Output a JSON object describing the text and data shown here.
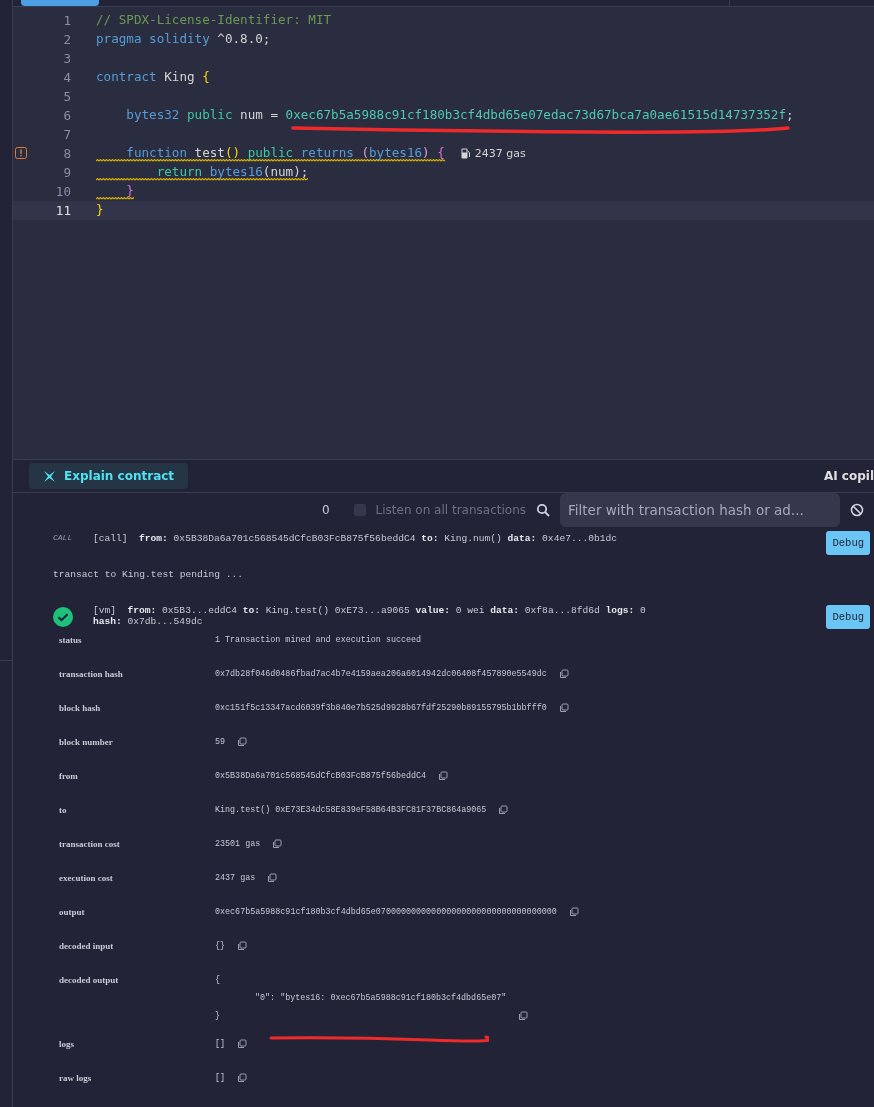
{
  "editor": {
    "lines": [
      {
        "number": "1",
        "warning": false,
        "current": false,
        "tokens": [
          {
            "kind": "comment",
            "text": "// SPDX-License-Identifier: MIT"
          }
        ]
      },
      {
        "number": "2",
        "warning": false,
        "current": false,
        "tokens": [
          {
            "kind": "keyword",
            "text": "pragma solidity"
          },
          {
            "kind": "plain",
            "text": " ^0.8.0;"
          }
        ]
      },
      {
        "number": "3",
        "warning": false,
        "current": false
      },
      {
        "number": "4",
        "warning": false,
        "current": false,
        "tokens": [
          {
            "kind": "keyword",
            "text": "contract"
          },
          {
            "kind": "plain",
            "text": " King "
          },
          {
            "kind": "brace",
            "text": "{"
          }
        ]
      },
      {
        "number": "5",
        "warning": false,
        "current": false
      },
      {
        "number": "6",
        "warning": false,
        "current": false,
        "tokens": [
          {
            "kind": "keyword",
            "text": "    bytes32 "
          },
          {
            "kind": "modifier",
            "text": "public"
          },
          {
            "kind": "plain",
            "text": " num = "
          },
          {
            "kind": "literal",
            "text": "0xec67b5a5988c91cf180b3cf4dbd65e07edac73d67bca7a0ae61515d14737352f"
          },
          {
            "kind": "plain",
            "text": ";"
          }
        ]
      },
      {
        "number": "7",
        "warning": false,
        "current": false
      },
      {
        "number": "8",
        "warning": true,
        "current": false,
        "gutter_warning": true,
        "gas": "2437 gas",
        "tokens": [
          {
            "kind": "keyword",
            "text": "    function"
          },
          {
            "kind": "plain",
            "text": " test"
          },
          {
            "kind": "brace",
            "text": "() "
          },
          {
            "kind": "modifier",
            "text": "public "
          },
          {
            "kind": "keyword",
            "text": "returns "
          },
          {
            "kind": "paren",
            "text": "("
          },
          {
            "kind": "keyword",
            "text": "bytes16"
          },
          {
            "kind": "paren",
            "text": ") "
          },
          {
            "kind": "brace2",
            "text": "{"
          }
        ]
      },
      {
        "number": "9",
        "warning": true,
        "current": false,
        "tokens": [
          {
            "kind": "modifier",
            "text": "        return "
          },
          {
            "kind": "keyword",
            "text": "bytes16"
          },
          {
            "kind": "plain",
            "text": "(num);"
          }
        ]
      },
      {
        "number": "10",
        "warning": true,
        "current": false,
        "tokens": [
          {
            "kind": "brace2",
            "text": "    }"
          }
        ]
      },
      {
        "number": "11",
        "warning": false,
        "current": true,
        "tokens": [
          {
            "kind": "brace",
            "text": "}"
          }
        ]
      }
    ]
  },
  "ai_bar": {
    "explain_button": "Explain contract",
    "copilot_label": "AI copil"
  },
  "terminal": {
    "count": "0",
    "listen_all": {
      "label": "Listen on all transactions",
      "checked": false
    },
    "filter": {
      "placeholder": "Filter with transaction hash or ad..."
    },
    "entries": [
      {
        "kind": "call",
        "badge": "CALL",
        "text": "[call]  **from:** 0x5B38Da6a701c568545dCfcB03FcB875f56beddC4 **to:** King.num() **data:** 0x4e7...0b1dc",
        "button": "Debug"
      },
      {
        "kind": "info",
        "text": "transact to King.test pending ..."
      },
      {
        "kind": "tx",
        "text": "[vm]  **from:** 0x5B3...eddC4 **to:** King.test() 0xE73...a9065 **value:** 0 wei **data:** 0xf8a...8fd6d **logs:** 0",
        "hash": "**hash:** 0x7db...549dc",
        "button": "Debug"
      }
    ],
    "details": [
      {
        "label": "status",
        "value": [
          "1 Transaction mined and execution succeed"
        ],
        "copy": false
      },
      {
        "label": "transaction hash",
        "value": [
          "0x7db28f046d0486fbad7ac4b7e4159aea206a6014942dc06408f457890e5549dc"
        ],
        "copy": true
      },
      {
        "label": "block hash",
        "value": [
          "0xc151f5c13347acd6039f3b840e7b525d9928b67fdf25290b89155795b1bbfff0"
        ],
        "copy": true
      },
      {
        "label": "block number",
        "value": [
          "59"
        ],
        "copy": true
      },
      {
        "label": "from",
        "value": [
          "0x5B38Da6a701c568545dCfcB03FcB875f56beddC4"
        ],
        "copy": true
      },
      {
        "label": "to",
        "value": [
          "King.test() 0xE73E34dc58E839eF58B64B3FC81F37BC864a9065"
        ],
        "copy": true
      },
      {
        "label": "transaction cost",
        "value": [
          "23501 gas"
        ],
        "copy": true
      },
      {
        "label": "execution cost",
        "value": [
          "2437 gas"
        ],
        "copy": true
      },
      {
        "label": "output",
        "value": [
          "0xec67b5a5988c91cf180b3cf4dbd65e070000000000000000000000000000000000"
        ],
        "copy": true
      },
      {
        "label": "decoded input",
        "value": [
          "{}"
        ],
        "copy": true
      },
      {
        "label": "decoded output",
        "value": [
          "{",
          "\"0\": \"bytes16: 0xec67b5a5988c91cf180b3cf4dbd65e07\"",
          "}"
        ],
        "copy": true,
        "scribble": true
      },
      {
        "label": "logs",
        "value": [
          "[]"
        ],
        "copy": true
      },
      {
        "label": "raw logs",
        "value": [
          "[]"
        ],
        "copy": true
      }
    ]
  }
}
